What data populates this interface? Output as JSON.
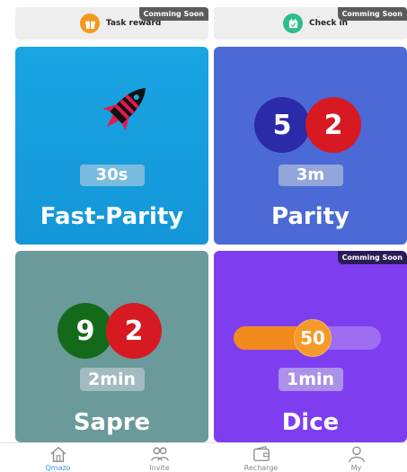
{
  "top_cards": {
    "task": {
      "label": "Task reward",
      "badge": "Comming Soon",
      "icon": "gift-icon",
      "icon_color": "#f39a1e"
    },
    "checkin": {
      "label": "Check in",
      "badge": "Comming Soon",
      "icon": "calendar-icon",
      "icon_color": "#2dbd8a"
    }
  },
  "games": {
    "fast_parity": {
      "name": "Fast-Parity",
      "timer": "30s",
      "icon": "rocket-icon",
      "color": "#1ba3e0"
    },
    "parity": {
      "name": "Parity",
      "timer": "3m",
      "ball_left": "5",
      "ball_right": "2",
      "color": "#4b6ad6"
    },
    "sapre": {
      "name": "Sapre",
      "timer": "2min",
      "ball_left": "9",
      "ball_right": "2",
      "color": "#6b9a9a"
    },
    "dice": {
      "name": "Dice",
      "timer": "1min",
      "slider_value": "50",
      "slider_level": 0.5,
      "badge": "Comming Soon",
      "color": "#7e3ef0"
    }
  },
  "tabbar": {
    "items": [
      {
        "label": "Qmazo",
        "icon": "home-icon"
      },
      {
        "label": "Invite",
        "icon": "users-icon"
      },
      {
        "label": "Recharge",
        "icon": "wallet-icon"
      },
      {
        "label": "My",
        "icon": "user-icon"
      }
    ]
  }
}
